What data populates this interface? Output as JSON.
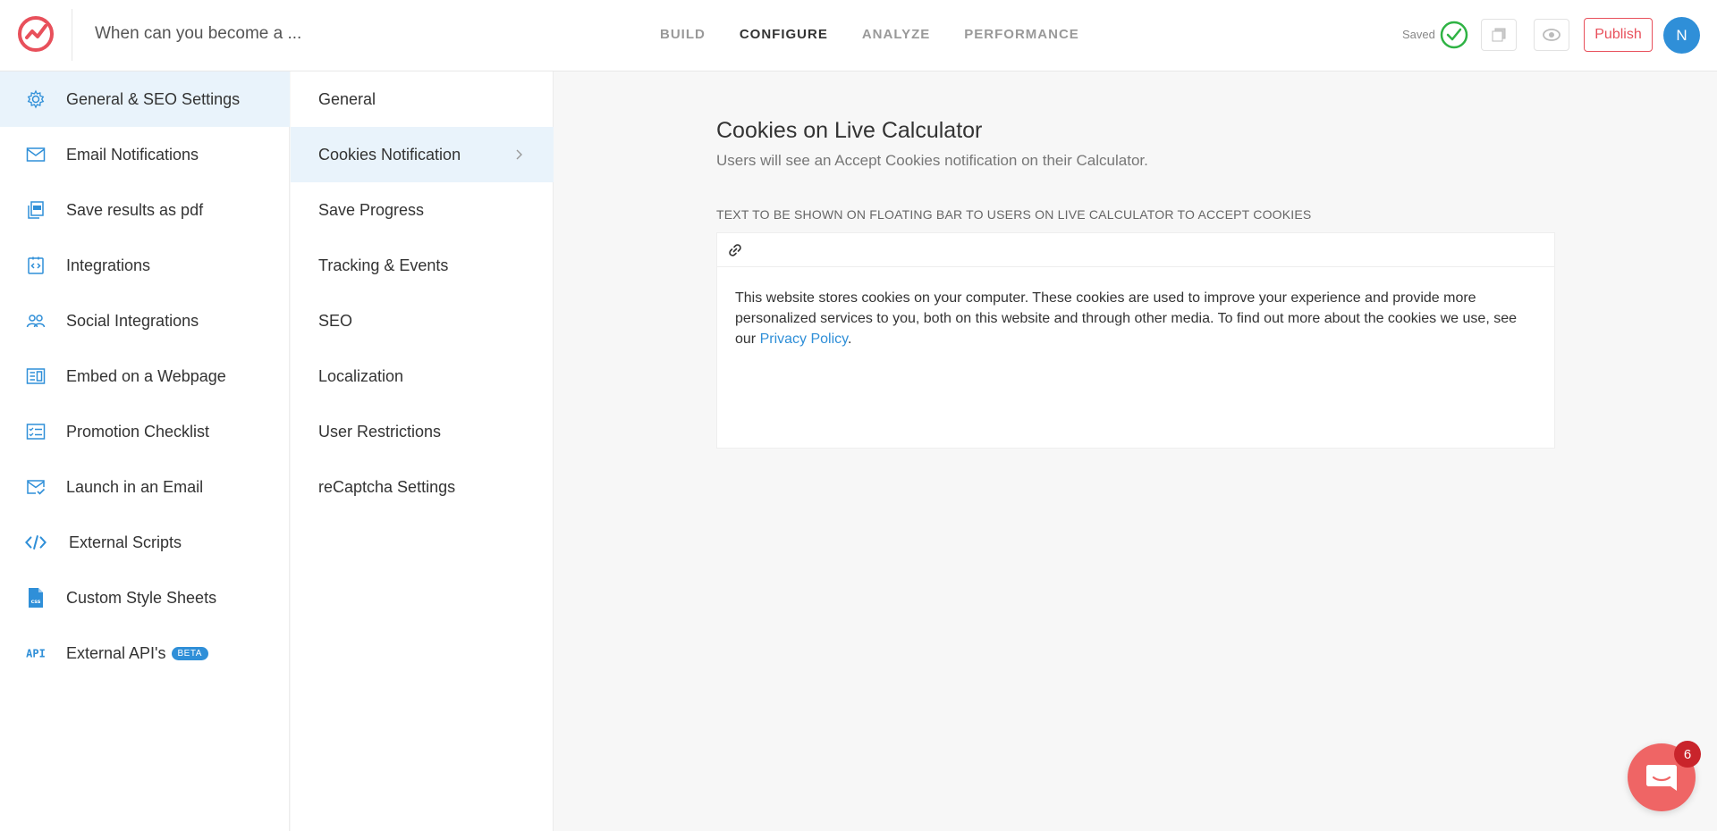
{
  "header": {
    "doc_title": "When can you become a ...",
    "nav": [
      "BUILD",
      "CONFIGURE",
      "ANALYZE",
      "PERFORMANCE"
    ],
    "active_nav": "CONFIGURE",
    "saved_label": "Saved",
    "publish_label": "Publish",
    "avatar_initial": "N"
  },
  "sidebar": {
    "items": [
      {
        "label": "General & SEO Settings",
        "icon": "gear-icon",
        "active": true
      },
      {
        "label": "Email Notifications",
        "icon": "envelope-icon"
      },
      {
        "label": "Save results as pdf",
        "icon": "pdf-icon"
      },
      {
        "label": "Integrations",
        "icon": "integrations-icon"
      },
      {
        "label": "Social Integrations",
        "icon": "people-icon"
      },
      {
        "label": "Embed on a Webpage",
        "icon": "embed-icon"
      },
      {
        "label": "Promotion Checklist",
        "icon": "checklist-icon"
      },
      {
        "label": "Launch in an Email",
        "icon": "email-check-icon"
      },
      {
        "label": "External Scripts",
        "icon": "code-icon"
      },
      {
        "label": "Custom Style Sheets",
        "icon": "css-file-icon"
      },
      {
        "label": "External API's",
        "icon": "api-icon",
        "badge": "BETA"
      }
    ]
  },
  "submenu": {
    "items": [
      {
        "label": "General"
      },
      {
        "label": "Cookies Notification",
        "active": true
      },
      {
        "label": "Save Progress"
      },
      {
        "label": "Tracking & Events"
      },
      {
        "label": "SEO"
      },
      {
        "label": "Localization"
      },
      {
        "label": "User Restrictions"
      },
      {
        "label": "reCaptcha Settings"
      }
    ]
  },
  "main": {
    "heading": "Cookies on Live Calculator",
    "subheading": "Users will see an Accept Cookies notification on their Calculator.",
    "field_label": "TEXT TO BE SHOWN ON FLOATING BAR TO USERS ON LIVE CALCULATOR TO ACCEPT COOKIES",
    "editor_text": "This website stores cookies on your computer. These cookies are used to improve your experience and provide more personalized services to you, both on this website and through other media. To find out more about the cookies we use, see our",
    "editor_link": "Privacy Policy",
    "editor_suffix": "."
  },
  "chat": {
    "badge_count": "6"
  },
  "colors": {
    "brand_red": "#e8505b",
    "accent_blue": "#2f8fd8",
    "active_bg": "#e9f3fb",
    "success_green": "#2fb344"
  }
}
